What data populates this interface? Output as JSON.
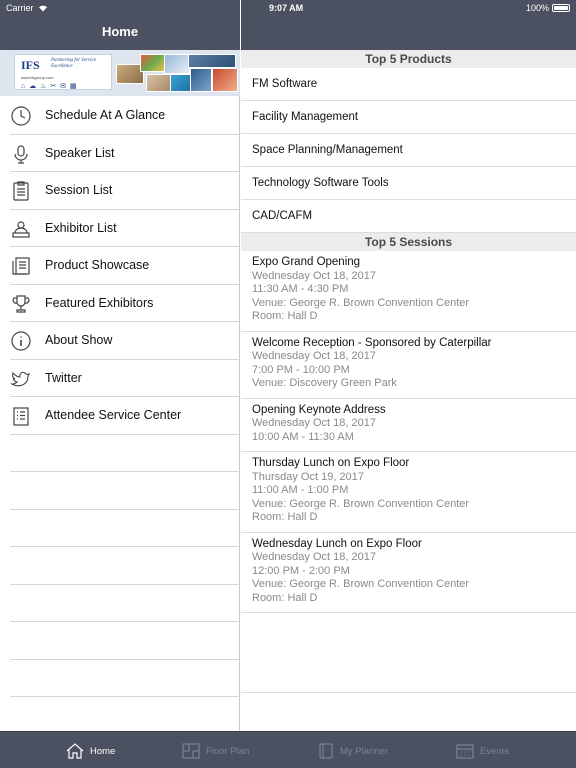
{
  "status_bar": {
    "carrier": "Carrier",
    "time": "9:07 AM",
    "battery": "100%"
  },
  "sidebar": {
    "title": "Home",
    "banner": {
      "logo_text": "IFS",
      "tagline": "Partnering for Service Excellence",
      "url": "www.ifsgroup.com"
    },
    "items": [
      {
        "label": "Schedule At A Glance",
        "icon": "clock-icon"
      },
      {
        "label": "Speaker List",
        "icon": "microphone-icon"
      },
      {
        "label": "Session List",
        "icon": "clipboard-icon"
      },
      {
        "label": "Exhibitor List",
        "icon": "booth-icon"
      },
      {
        "label": "Product Showcase",
        "icon": "catalog-icon"
      },
      {
        "label": "Featured Exhibitors",
        "icon": "trophy-icon"
      },
      {
        "label": "About Show",
        "icon": "info-icon"
      },
      {
        "label": "Twitter",
        "icon": "twitter-icon"
      },
      {
        "label": "Attendee Service Center",
        "icon": "list-icon"
      }
    ]
  },
  "main": {
    "products_header": "Top 5 Products",
    "products": [
      "FM Software",
      "Facility Management",
      "Space Planning/Management",
      "Technology Software Tools",
      "CAD/CAFM"
    ],
    "sessions_header": "Top 5 Sessions",
    "sessions": [
      {
        "title": "Expo Grand Opening",
        "date": "Wednesday Oct 18, 2017",
        "time": "11:30 AM - 4:30 PM",
        "venue": "Venue: George R. Brown Convention Center",
        "room": "Room: Hall D"
      },
      {
        "title": "Welcome Reception - Sponsored by Caterpillar",
        "date": "Wednesday Oct 18, 2017",
        "time": "7:00 PM - 10:00 PM",
        "venue": "Venue: Discovery Green Park",
        "room": ""
      },
      {
        "title": "Opening Keynote Address",
        "date": "Wednesday Oct 18, 2017",
        "time": "10:00 AM - 11:30 AM",
        "venue": "",
        "room": ""
      },
      {
        "title": "Thursday Lunch on Expo Floor",
        "date": "Thursday Oct 19, 2017",
        "time": "11:00 AM - 1:00 PM",
        "venue": "Venue: George R. Brown Convention Center",
        "room": "Room: Hall D"
      },
      {
        "title": "Wednesday Lunch on Expo Floor",
        "date": "Wednesday Oct 18, 2017",
        "time": "12:00 PM - 2:00 PM",
        "venue": "Venue: George R. Brown Convention Center",
        "room": "Room: Hall D"
      }
    ]
  },
  "tabbar": {
    "tabs": [
      {
        "label": "Home",
        "icon": "home-icon",
        "active": true
      },
      {
        "label": "Floor Plan",
        "icon": "floor-plan-icon",
        "active": false
      },
      {
        "label": "My Planner",
        "icon": "planner-icon",
        "active": false
      },
      {
        "label": "Events",
        "icon": "calendar-icon",
        "active": false
      }
    ]
  },
  "colors": {
    "header_bg": "#4b5160",
    "section_header_bg": "#ececef",
    "active_tab": "#ffffff",
    "inactive_tab": "#7b8191",
    "secondary_text": "#8a8a8e"
  }
}
